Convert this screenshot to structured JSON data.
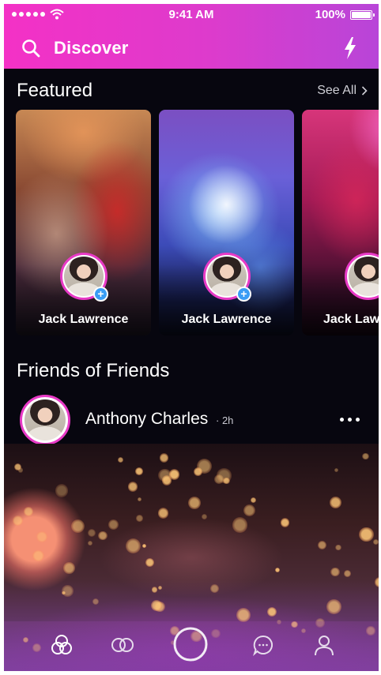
{
  "status_bar": {
    "time": "9:41 AM",
    "battery": "100%",
    "signal_icon": "signal-dots-icon",
    "wifi_icon": "wifi-icon"
  },
  "nav": {
    "title": "Discover",
    "search_icon": "search-icon",
    "action_icon": "lightning-bolt-icon"
  },
  "featured": {
    "title": "Featured",
    "see_all": "See All",
    "cards": [
      {
        "name": "Jack Lawrence"
      },
      {
        "name": "Jack Lawrence"
      },
      {
        "name": "Jack Law"
      }
    ]
  },
  "friends_of_friends": {
    "title": "Friends of Friends",
    "post": {
      "author": "Anthony Charles",
      "time": "· 2h"
    }
  },
  "tabbar": {
    "items": [
      "home-rings-icon",
      "circles-icon",
      "record-icon",
      "chat-icon",
      "profile-icon"
    ]
  },
  "colors": {
    "accent_pink": "#e83ac6",
    "header_gradient_start": "#f431c6",
    "header_gradient_end": "#b845d8",
    "background": "#07060f",
    "badge_blue": "#3a9df5"
  }
}
